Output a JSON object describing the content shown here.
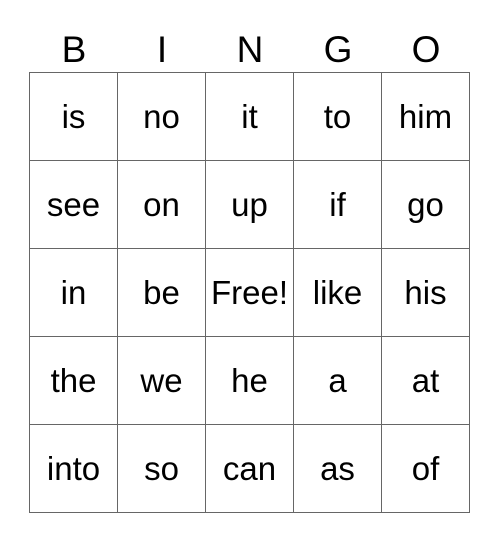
{
  "header": [
    "B",
    "I",
    "N",
    "G",
    "O"
  ],
  "rows": [
    [
      "is",
      "no",
      "it",
      "to",
      "him"
    ],
    [
      "see",
      "on",
      "up",
      "if",
      "go"
    ],
    [
      "in",
      "be",
      "Free!",
      "like",
      "his"
    ],
    [
      "the",
      "we",
      "he",
      "a",
      "at"
    ],
    [
      "into",
      "so",
      "can",
      "as",
      "of"
    ]
  ]
}
